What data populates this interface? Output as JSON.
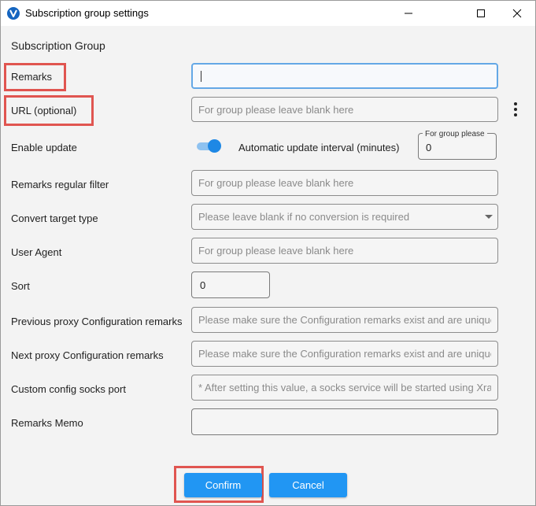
{
  "window": {
    "title": "Subscription group settings"
  },
  "section_header": "Subscription Group",
  "fields": {
    "remarks": {
      "label": "Remarks",
      "value": "",
      "placeholder": ""
    },
    "url": {
      "label": "URL (optional)",
      "placeholder": "For group please leave blank here"
    },
    "enable_update": {
      "label": "Enable update",
      "toggle_on": true
    },
    "interval": {
      "label": "Automatic update interval (minutes)",
      "hint": "For group please",
      "value": "0"
    },
    "filter": {
      "label": "Remarks regular filter",
      "placeholder": "For group please leave blank here"
    },
    "convert_target": {
      "label": "Convert target type",
      "placeholder": "Please leave blank if no conversion is required"
    },
    "user_agent": {
      "label": "User Agent",
      "placeholder": "For group please leave blank here"
    },
    "sort": {
      "label": "Sort",
      "value": "0"
    },
    "prev_proxy": {
      "label": "Previous proxy Configuration remarks",
      "placeholder": "Please make sure the Configuration remarks exist and are unique"
    },
    "next_proxy": {
      "label": "Next proxy Configuration remarks",
      "placeholder": "Please make sure the Configuration remarks exist and are unique"
    },
    "socks_port": {
      "label": "Custom config socks port",
      "placeholder": "* After setting this value, a socks service will be started using Xray"
    },
    "memo": {
      "label": "Remarks Memo",
      "value": ""
    }
  },
  "buttons": {
    "confirm": "Confirm",
    "cancel": "Cancel"
  },
  "colors": {
    "accent": "#2196f3",
    "highlight": "#e05550",
    "focus": "#64a8e6"
  },
  "icons": [
    "app-icon",
    "minimize-icon",
    "maximize-icon",
    "close-icon",
    "more-vertical-icon",
    "dropdown-arrow-icon"
  ]
}
